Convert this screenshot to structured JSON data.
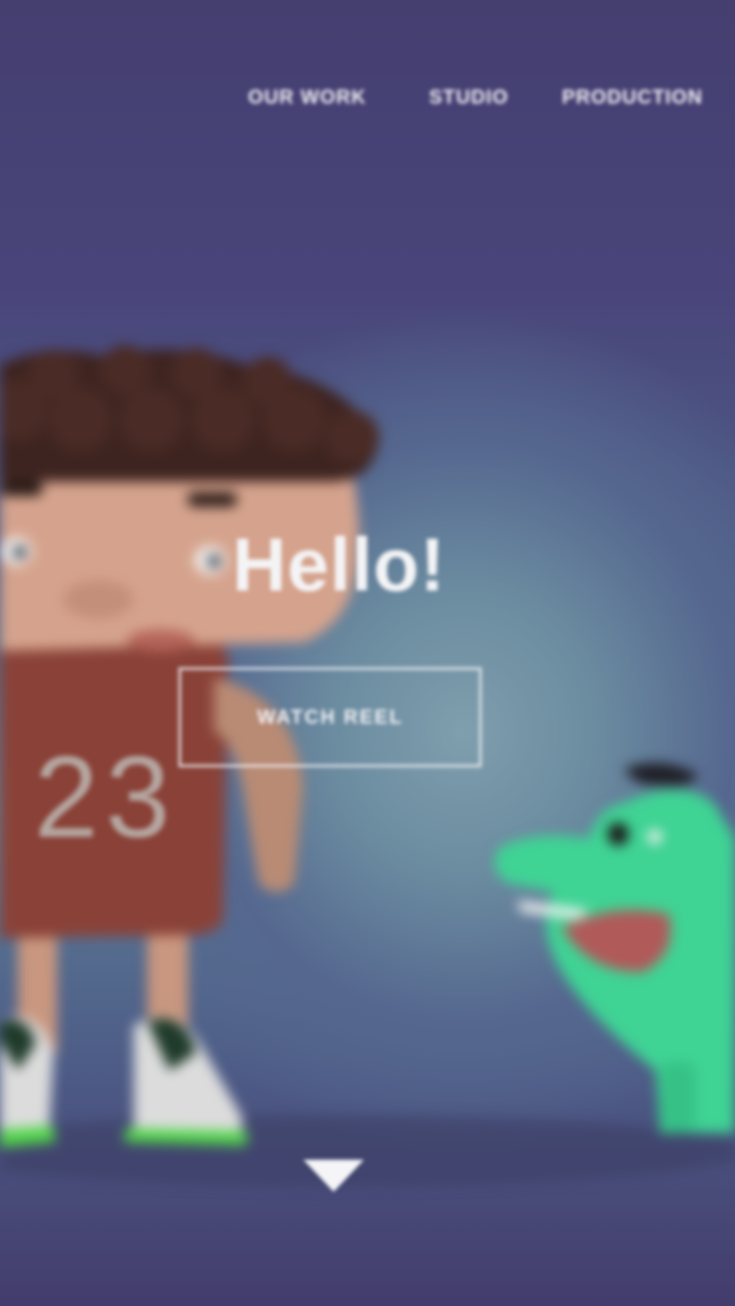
{
  "nav": {
    "items": [
      {
        "label": "OUR WORK"
      },
      {
        "label": "STUDIO"
      },
      {
        "label": "PRODUCTION"
      }
    ]
  },
  "hero": {
    "title": "Hello!",
    "button_label": "WATCH REEL"
  },
  "characters": {
    "boy": {
      "jersey_number": "23"
    }
  },
  "colors": {
    "background": "#463f6e",
    "text": "#f2f2f6",
    "jersey": "#8a4238",
    "dinosaur": "#3fd394"
  },
  "icons": {
    "scroll": "triangle-down-icon"
  }
}
